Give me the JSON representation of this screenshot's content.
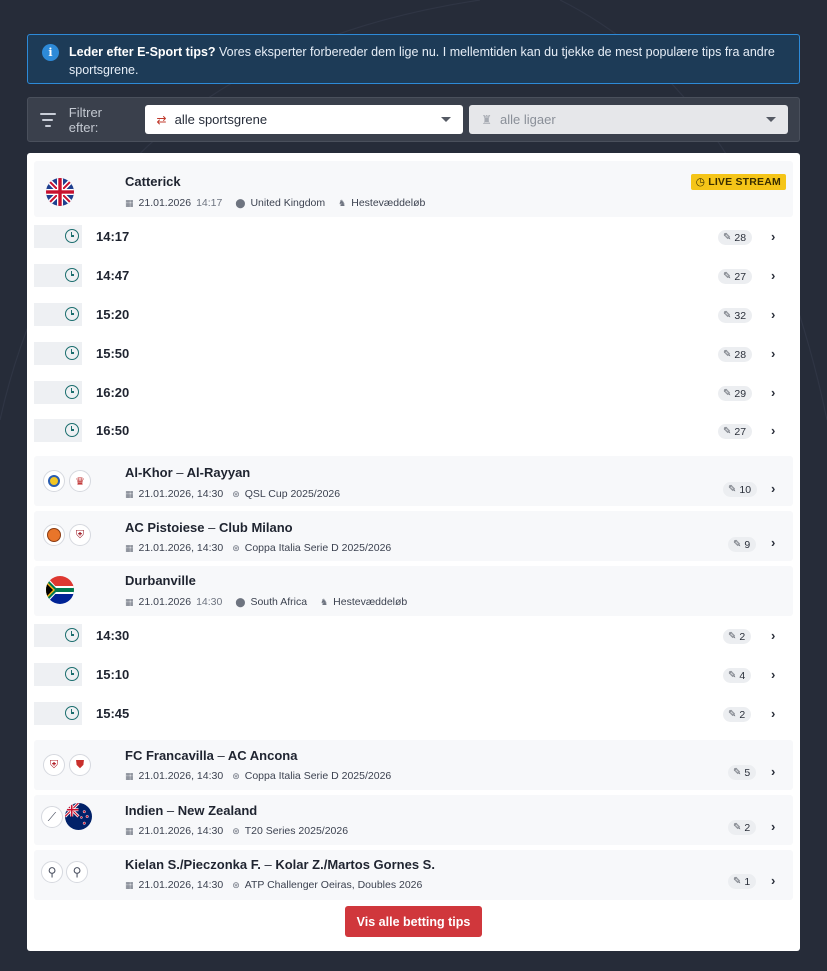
{
  "banner": {
    "bold": "Leder efter E-Sport tips?",
    "text": " Vores eksperter forbereder dem lige nu. I mellemtiden kan du tjekke de mest populære tips fra andre sportsgrene."
  },
  "filter": {
    "label": "Filtrer efter:",
    "sport_value": "alle sportsgrene",
    "league_value": "alle ligaer"
  },
  "live_badge": "LIVE STREAM",
  "events": {
    "catterick": {
      "name": "Catterick",
      "date": "21.01.2026",
      "time": "14:17",
      "country": "United Kingdom",
      "sport": "Hestevæddeløb",
      "races": [
        {
          "time": "14:17",
          "tips": "28"
        },
        {
          "time": "14:47",
          "tips": "27"
        },
        {
          "time": "15:20",
          "tips": "32"
        },
        {
          "time": "15:50",
          "tips": "28"
        },
        {
          "time": "16:20",
          "tips": "29"
        },
        {
          "time": "16:50",
          "tips": "27"
        }
      ]
    },
    "alkhor": {
      "home": "Al-Khor",
      "away": "Al-Rayyan",
      "datetime": "21.01.2026, 14:30",
      "league": "QSL Cup 2025/2026",
      "tips": "10"
    },
    "pistoiese": {
      "home": "AC Pistoiese",
      "away": "Club Milano",
      "datetime": "21.01.2026, 14:30",
      "league": "Coppa Italia Serie D 2025/2026",
      "tips": "9"
    },
    "durbanville": {
      "name": "Durbanville",
      "date": "21.01.2026",
      "time": "14:30",
      "country": "South Africa",
      "sport": "Hestevæddeløb",
      "races": [
        {
          "time": "14:30",
          "tips": "2"
        },
        {
          "time": "15:10",
          "tips": "4"
        },
        {
          "time": "15:45",
          "tips": "2"
        }
      ]
    },
    "francavilla": {
      "home": "FC Francavilla",
      "away": "AC Ancona",
      "datetime": "21.01.2026, 14:30",
      "league": "Coppa Italia Serie D 2025/2026",
      "tips": "5"
    },
    "indien": {
      "home": "Indien",
      "away": "New Zealand",
      "datetime": "21.01.2026, 14:30",
      "league": "T20 Series 2025/2026",
      "tips": "2"
    },
    "kielan": {
      "home": "Kielan S./Pieczonka F.",
      "away": "Kolar Z./Martos Gornes S.",
      "datetime": "21.01.2026, 14:30",
      "league": "ATP Challenger Oeiras, Doubles 2026",
      "tips": "1"
    }
  },
  "separator": "–",
  "cta_label": "Vis alle betting tips"
}
